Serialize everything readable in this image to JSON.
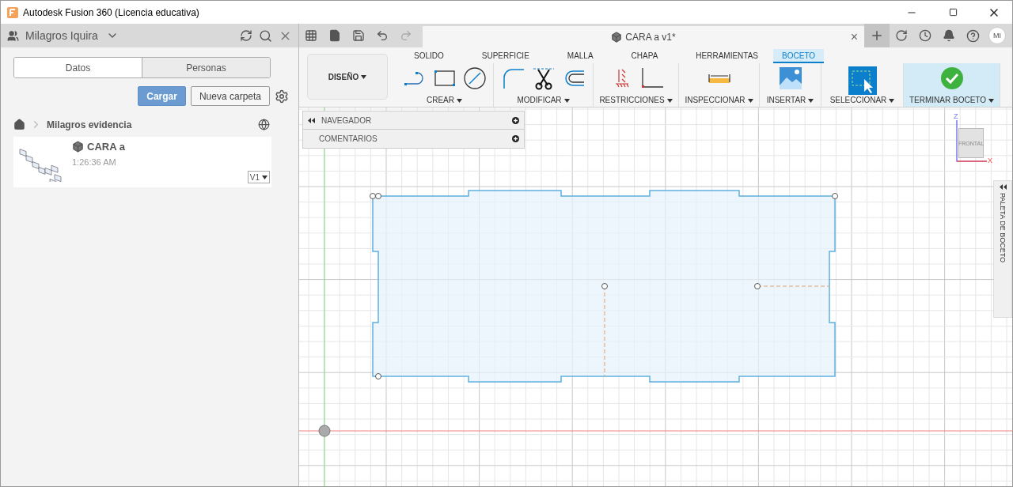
{
  "window": {
    "title": "Autodesk Fusion 360 (Licencia educativa)"
  },
  "data_panel": {
    "user": "Milagros Iquira",
    "tabs": [
      {
        "label": "Datos",
        "selected": true
      },
      {
        "label": "Personas",
        "selected": false
      }
    ],
    "buttons": [
      "Cargar",
      "Nueva carpeta"
    ],
    "breadcrumb": "Milagros evidencia",
    "files": [
      {
        "name": "CARA a",
        "time": "1:26:36 AM",
        "version": "V1"
      }
    ]
  },
  "document_tab": {
    "title": "CARA a v1*",
    "close": "×"
  },
  "avatar": "MI",
  "workspace": "DISEÑO",
  "ribbon_tabs": [
    {
      "label": "SOLIDO",
      "selected": false
    },
    {
      "label": "SUPERFICIE",
      "selected": false
    },
    {
      "label": "MALLA",
      "selected": false
    },
    {
      "label": "CHAPA",
      "selected": false
    },
    {
      "label": "HERRAMIENTAS",
      "selected": false
    },
    {
      "label": "BOCETO",
      "selected": true
    }
  ],
  "tool_groups": [
    {
      "label": "CREAR"
    },
    {
      "label": "MODIFICAR"
    },
    {
      "label": "RESTRICCIONES"
    },
    {
      "label": "INSPECCIONAR"
    },
    {
      "label": "INSERTAR"
    },
    {
      "label": "SELECCIONAR"
    },
    {
      "label": "TERMINAR BOCETO"
    }
  ],
  "browser": [
    {
      "label": "NAVEGADOR"
    },
    {
      "label": "COMENTARIOS"
    }
  ],
  "view_cube": {
    "face": "FRONTAL",
    "z": "Z",
    "x": "X"
  },
  "palette": {
    "label": "PALETA DE BOCETO"
  }
}
